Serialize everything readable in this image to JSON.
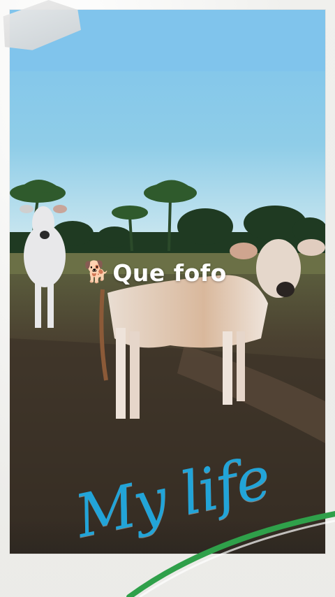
{
  "sticker": {
    "icon": "dog-icon",
    "emoji": "🐕",
    "text": "Que fofo"
  },
  "caption": {
    "text": "My life",
    "color": "#22a4d8"
  },
  "colors": {
    "frame": "#f3f3f1",
    "swoosh": "#2fa04a"
  }
}
